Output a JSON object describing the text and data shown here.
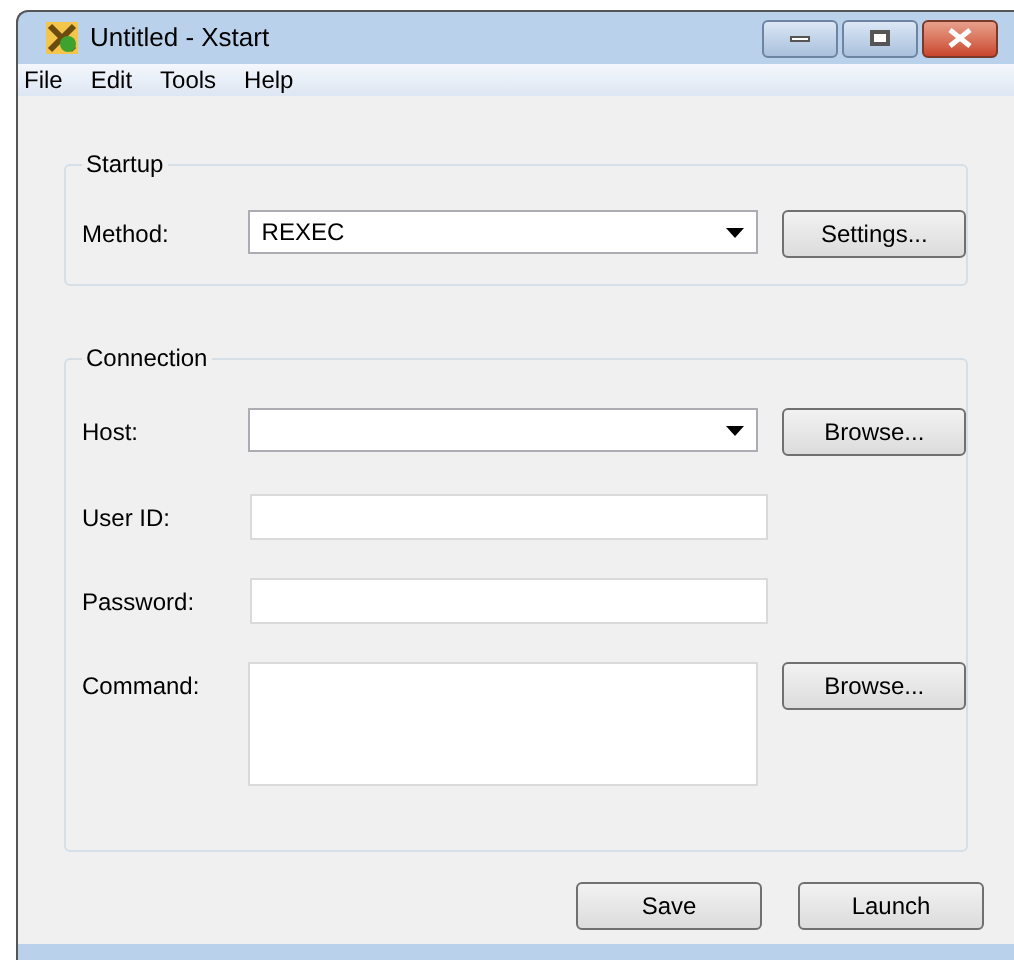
{
  "window": {
    "title": "Untitled - Xstart"
  },
  "menu": [
    "File",
    "Edit",
    "Tools",
    "Help"
  ],
  "startup": {
    "title": "Startup",
    "rows": [
      {
        "label": "Method:",
        "kind": "combo",
        "value": "REXEC",
        "button": "Settings..."
      }
    ]
  },
  "connection": {
    "title": "Connection",
    "rows": [
      {
        "label": "Host:",
        "kind": "combo",
        "button": "Browse..."
      },
      {
        "label": "User ID:",
        "kind": "text"
      },
      {
        "label": "Password:",
        "kind": "text"
      },
      {
        "label": "Command:",
        "kind": "multiline",
        "button": "Browse..."
      }
    ]
  },
  "buttons": [
    "Save",
    "Launch"
  ]
}
